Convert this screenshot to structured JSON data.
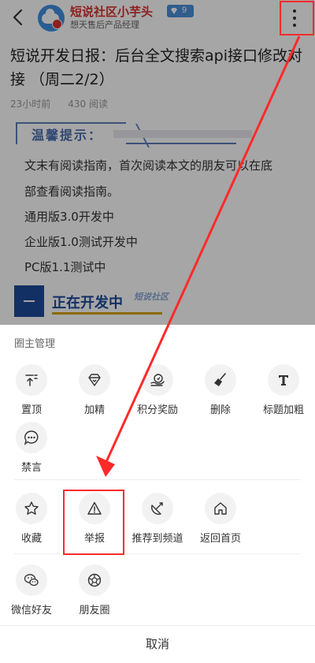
{
  "header": {
    "author_name": "短说社区小芋头",
    "author_title": "想天售后产品经理",
    "level": "9"
  },
  "article": {
    "title": "短说开发日报：后台全文搜索api接口修改对接 （周二2/2）",
    "time": "23小时前",
    "reads": "430 阅读",
    "tip_label": "温馨提示：",
    "paragraphs": [
      "文末有阅读指南，首次阅读本文的朋友可以在底",
      "部查看阅读指南。",
      "通用版3.0开发中",
      "企业版1.0测试开发中",
      "PC版1.1测试中"
    ],
    "banner_text": "正在开发中",
    "banner_logo": "短说社区"
  },
  "sheet": {
    "section_title": "圈主管理",
    "admin_actions": [
      {
        "label": "置顶",
        "icon": "pin-top-icon"
      },
      {
        "label": "加精",
        "icon": "diamond-icon"
      },
      {
        "label": "积分奖励",
        "icon": "reward-icon"
      },
      {
        "label": "删除",
        "icon": "broom-icon"
      },
      {
        "label": "标题加粗",
        "icon": "bold-t-icon"
      },
      {
        "label": "禁言",
        "icon": "mute-chat-icon"
      }
    ],
    "common_actions": [
      {
        "label": "收藏",
        "icon": "star-icon"
      },
      {
        "label": "举报",
        "icon": "warning-icon"
      },
      {
        "label": "推荐到频道",
        "icon": "recommend-icon"
      },
      {
        "label": "返回首页",
        "icon": "home-icon"
      }
    ],
    "share_actions": [
      {
        "label": "微信好友",
        "icon": "wechat-icon"
      },
      {
        "label": "朋友圈",
        "icon": "moments-icon"
      }
    ],
    "cancel": "取消"
  },
  "colors": {
    "highlight": "#ff2a2a",
    "author_name": "#d8322f",
    "sheet_bg": "#ffffff",
    "icon_bg": "#f2f2f2"
  }
}
